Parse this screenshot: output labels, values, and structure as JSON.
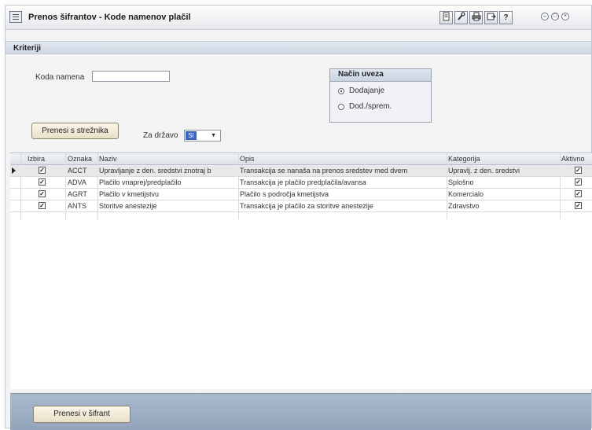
{
  "window": {
    "title": "Prenos šifrantov - Kode namenov plačil",
    "toolbar_icons": [
      "doc-icon",
      "wrench-icon",
      "print-icon",
      "export-icon",
      "help-icon"
    ],
    "help_glyph": "?",
    "window_controls": [
      "minimize-icon",
      "restore-icon",
      "close-icon"
    ]
  },
  "criteria": {
    "header": "Kriteriji",
    "code_label": "Koda namena",
    "code_value": "",
    "connection_group": {
      "title": "Način uveza",
      "options": [
        "Dodajanje",
        "Dod./sprem."
      ],
      "selected": "Dodajanje"
    },
    "transfer_server_button": "Prenesi s strežnika",
    "country_label": "Za državo",
    "country_value": "SI"
  },
  "table": {
    "columns": [
      "Izbira",
      "Oznaka",
      "Naziv",
      "Opis",
      "Kategorija",
      "Aktivno"
    ],
    "rows": [
      {
        "izbira": true,
        "oznaka": "ACCT",
        "naziv": "Upravljanje z den. sredstvi znotraj b",
        "opis": "Transakcija se nanaša na prenos sredstev med dvem",
        "kategorija": "Upravlj. z den. sredstvi",
        "aktivno": true
      },
      {
        "izbira": true,
        "oznaka": "ADVA",
        "naziv": "Plačilo vnaprej/predplačilo",
        "opis": "Transakcija je plačilo predplačila/avansa",
        "kategorija": "Splošno",
        "aktivno": true
      },
      {
        "izbira": true,
        "oznaka": "AGRT",
        "naziv": "Plačilo v kmetijstvu",
        "opis": "Plačilo s področja kmetijstva",
        "kategorija": "Komercialo",
        "aktivno": true
      },
      {
        "izbira": true,
        "oznaka": "ANTS",
        "naziv": "Storitve anestezije",
        "opis": "Transakcija je plačilo za storitve anestezije",
        "kategorija": "Zdravstvo",
        "aktivno": true
      }
    ],
    "selected_row": 0
  },
  "footer": {
    "transfer_button": "Prenesi v šifrant"
  },
  "colors": {
    "footer_band": "#9fb0c4",
    "section_header": "#d7dee9",
    "button_face": "#f2ebda"
  }
}
